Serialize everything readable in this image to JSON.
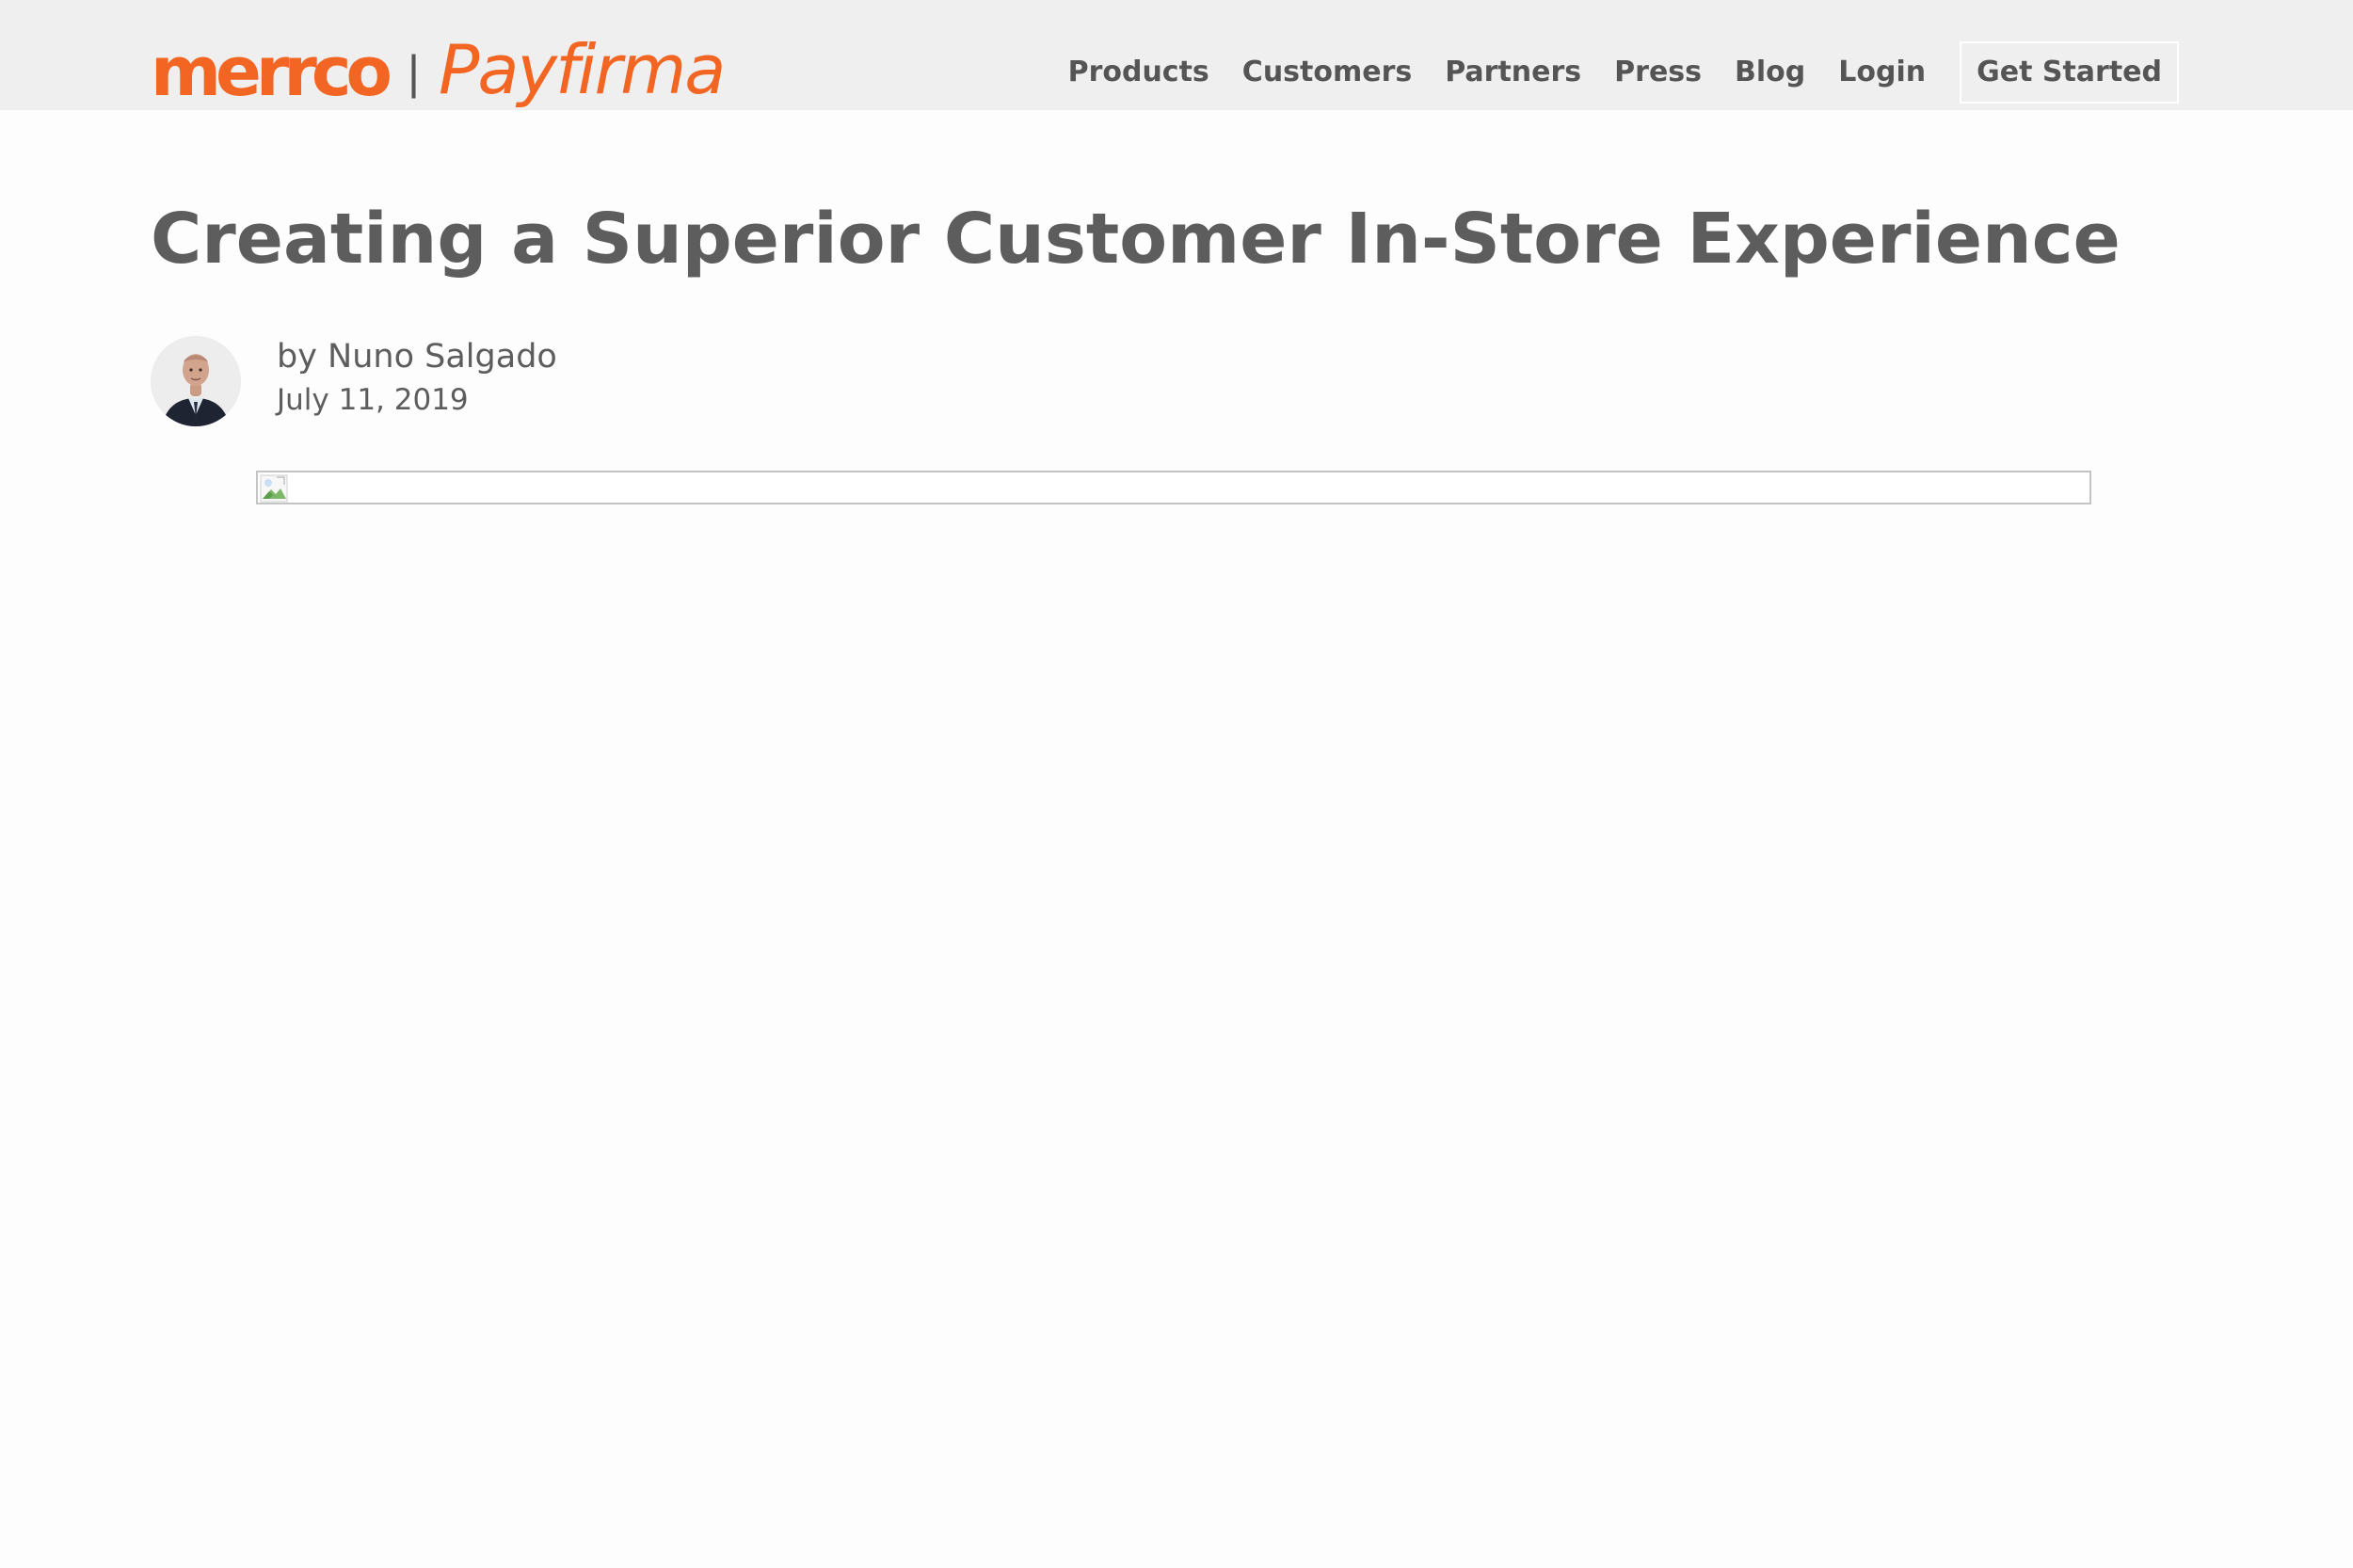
{
  "header": {
    "logo_primary": "merrco",
    "logo_separator": "|",
    "logo_secondary": "Payfirma",
    "nav_items": [
      "Products",
      "Customers",
      "Partners",
      "Press",
      "Blog",
      "Login"
    ],
    "cta_label": "Get Started"
  },
  "article": {
    "title": "Creating a Superior Customer In-Store Experience",
    "author": "by Nuno Salgado",
    "date": "July 11, 2019"
  },
  "icons": {
    "avatar": "author-avatar-photo",
    "hero_image": "broken-image-icon"
  },
  "colors": {
    "brand": "#f26522",
    "header_bg": "#efefef",
    "page_bg": "#fdfdfd",
    "text": "#5d5d5d",
    "nav_text": "#555555"
  }
}
